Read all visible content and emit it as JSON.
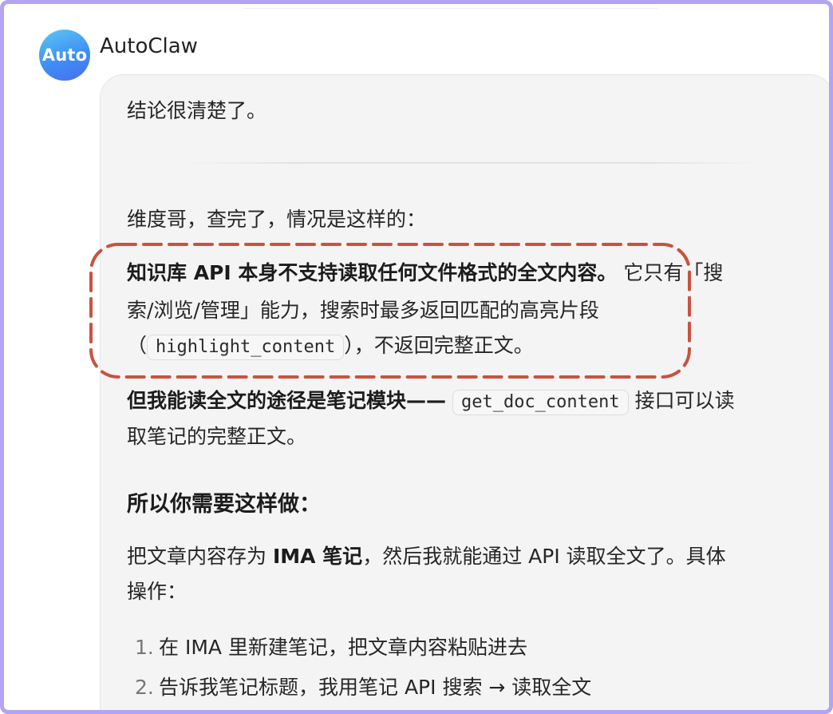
{
  "sender": {
    "avatar_text": "Auto",
    "name": "AutoClaw"
  },
  "message": {
    "intro": "结论很清楚了。",
    "greeting": "维度哥，查完了，情况是这样的：",
    "para1": {
      "bold": "知识库 API 本身不支持读取任何文件格式的全文内容。",
      "rest_line1": "它只有「搜",
      "line2": "索/浏览/管理」能力，搜索时最多返回匹配的高亮片段",
      "line3_open": "（",
      "code": "highlight_content",
      "line3_close": "），不返回完整正文。"
    },
    "para2": {
      "bold": "但我能读全文的途径是笔记模块——",
      "code": "get_doc_content",
      "rest_line1": "接口可以读",
      "line2": "取笔记的完整正文。"
    },
    "heading": "所以你需要这样做：",
    "para3": {
      "pre": "把文章内容存为 ",
      "bold": "IMA 笔记",
      "post": "，然后我就能通过 API 读取全文了。具体",
      "line2": "操作："
    },
    "steps": [
      {
        "num": "1.",
        "text": "在 IMA 里新建笔记，把文章内容粘贴进去"
      },
      {
        "num": "2.",
        "text": "告诉我笔记标题，我用笔记 API 搜索 → 读取全文"
      }
    ]
  },
  "colors": {
    "frame_border": "#b3a3f2",
    "bubble_bg": "#f4f4f5",
    "highlight_dash": "#c8533f",
    "avatar_gradient_start": "#5ec8f0",
    "avatar_gradient_end": "#4b6cf0"
  }
}
